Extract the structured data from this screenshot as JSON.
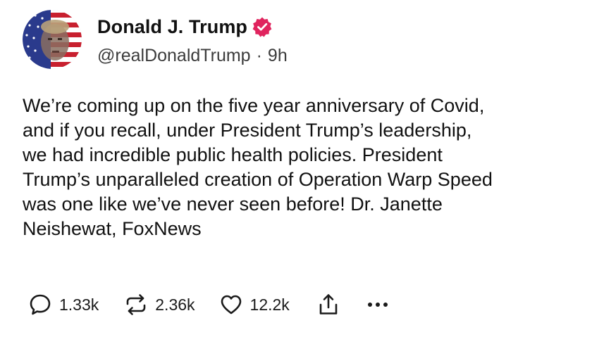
{
  "author": {
    "display_name": "Donald J. Trump",
    "handle": "@realDonaldTrump",
    "separator": "·",
    "time_ago": "9h",
    "verified": true,
    "verified_color": "#e0245e",
    "avatar_icon": "avatar-flag-portrait"
  },
  "post": {
    "text": "We’re coming up on the five year anniversary of Covid,\nand if you recall, under President Trump’s leadership,\nwe had incredible public health policies. President\nTrump’s unparalleled creation of Operation Warp Speed\nwas one like we’ve never seen before! Dr. Janette\nNeishewat, FoxNews"
  },
  "actions": {
    "reply_count": "1.33k",
    "repost_count": "2.36k",
    "like_count": "12.2k",
    "reply_icon": "speech-bubble-icon",
    "repost_icon": "repost-arrows-icon",
    "like_icon": "heart-icon",
    "share_icon": "share-upload-icon",
    "more_icon": "ellipsis-icon"
  },
  "colors": {
    "text": "#111111",
    "secondary_text": "#3c3c3c",
    "icon": "#1a1a1a",
    "verified": "#e0245e"
  }
}
